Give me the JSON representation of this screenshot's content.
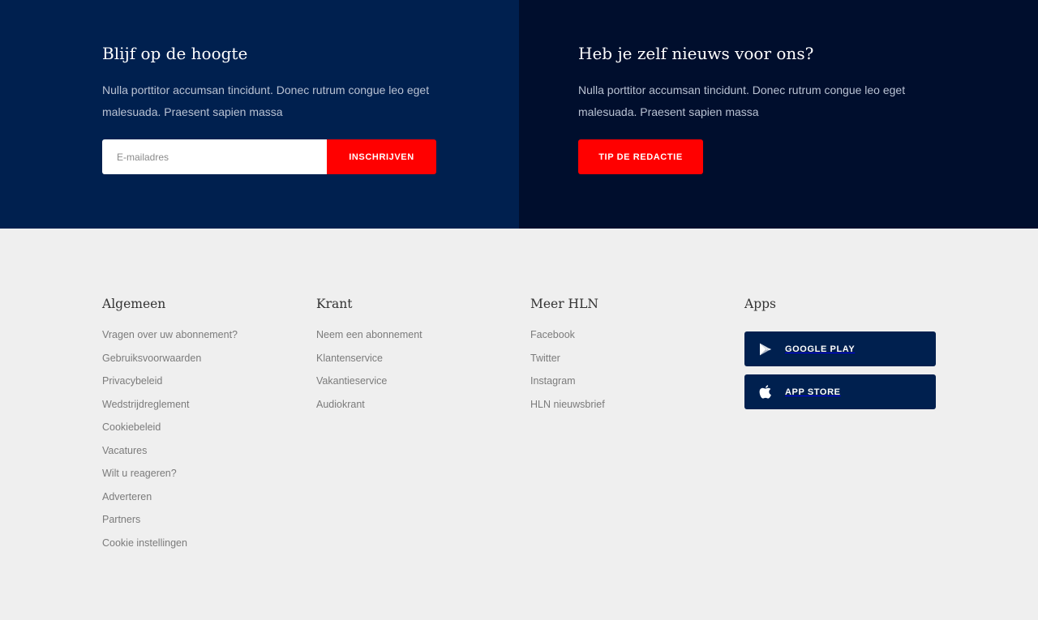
{
  "newsletter": {
    "title": "Blijf op de hoogte",
    "text": "Nulla porttitor accumsan tincidunt. Donec rutrum congue leo eget malesuada. Praesent sapien massa",
    "email_placeholder": "E-mailadres",
    "button_label": "INSCHRIJVEN"
  },
  "tip": {
    "title": "Heb je zelf nieuws voor ons?",
    "text": "Nulla porttitor accumsan tincidunt. Donec rutrum congue leo eget malesuada. Praesent sapien massa",
    "button_label": "TIP DE REDACTIE"
  },
  "footer": {
    "algemeen": {
      "title": "Algemeen",
      "links": [
        "Vragen over uw abonnement?",
        "Gebruiksvoorwaarden",
        "Privacybeleid",
        "Wedstrijdreglement",
        "Cookiebeleid",
        "Vacatures",
        "Wilt u reageren?",
        "Adverteren",
        "Partners",
        "Cookie instellingen"
      ]
    },
    "krant": {
      "title": "Krant",
      "links": [
        "Neem een abonnement",
        "Klantenservice",
        "Vakantieservice",
        "Audiokrant"
      ]
    },
    "meer": {
      "title": "Meer HLN",
      "links": [
        "Facebook",
        "Twitter",
        "Instagram",
        "HLN nieuwsbrief"
      ]
    },
    "apps": {
      "title": "Apps",
      "google_play": {
        "label": "GOOGLE PLAY",
        "icon": "google-play-icon"
      },
      "app_store": {
        "label": "APP STORE",
        "icon": "apple-icon"
      }
    }
  },
  "colors": {
    "navy": "#00204f",
    "dark_navy": "#000e2d",
    "accent_red": "#ff0000",
    "footer_bg": "#efefef"
  }
}
